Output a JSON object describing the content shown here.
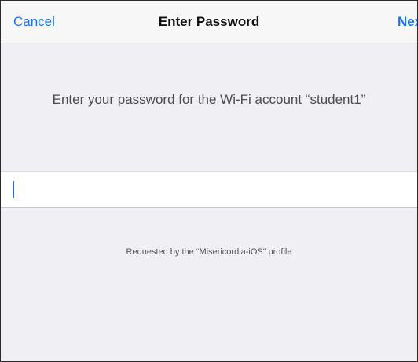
{
  "navbar": {
    "cancel_label": "Cancel",
    "title": "Enter Password",
    "next_label": "Next"
  },
  "prompt": {
    "text": "Enter your password for the Wi-Fi account “student1”"
  },
  "password_field": {
    "value": "",
    "placeholder": ""
  },
  "footer": {
    "note": "Requested by the “Misericordia-iOS” profile"
  },
  "colors": {
    "accent": "#1a74e8",
    "background": "#efeff4",
    "navbar_background": "#f7f7f7",
    "cursor": "#2e6fd9"
  }
}
